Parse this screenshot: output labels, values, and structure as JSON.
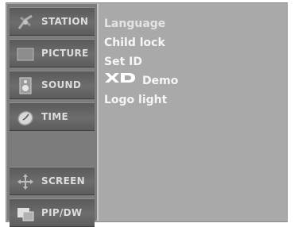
{
  "sidebar": {
    "items": [
      {
        "label": "STATION",
        "icon": "antenna-icon"
      },
      {
        "label": "PICTURE",
        "icon": "picture-icon"
      },
      {
        "label": "SOUND",
        "icon": "speaker-icon"
      },
      {
        "label": "TIME",
        "icon": "clock-icon"
      },
      {
        "label": "SCREEN",
        "icon": "arrows-icon"
      },
      {
        "label": "PIP/DW",
        "icon": "pip-icon"
      }
    ]
  },
  "menu": {
    "items": [
      {
        "label": "Language"
      },
      {
        "label": "Child lock"
      },
      {
        "label": "Set ID"
      },
      {
        "label": "Demo",
        "logo_text": "XD"
      },
      {
        "label": "Logo light"
      }
    ]
  },
  "colors": {
    "panel": "#a9a9a9",
    "sidebar": "#7c7c7c",
    "text": "#f6f6f6"
  }
}
